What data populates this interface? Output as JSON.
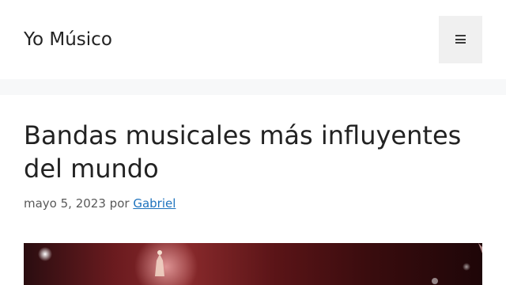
{
  "site": {
    "title": "Yo Músico"
  },
  "header": {
    "menu_icon": "hamburger-icon"
  },
  "post": {
    "title": "Bandas musicales más influyentes del mundo",
    "date": "mayo 5, 2023",
    "by_label": "por",
    "author": "Gabriel",
    "featured_image_desc": "concert-stage-photo"
  },
  "colors": {
    "page_bg": "#f7f8f9",
    "header_bg": "#ffffff",
    "text": "#222222",
    "meta_text": "#595959",
    "link": "#1e73be",
    "menu_button_bg": "#f0f0f0"
  }
}
